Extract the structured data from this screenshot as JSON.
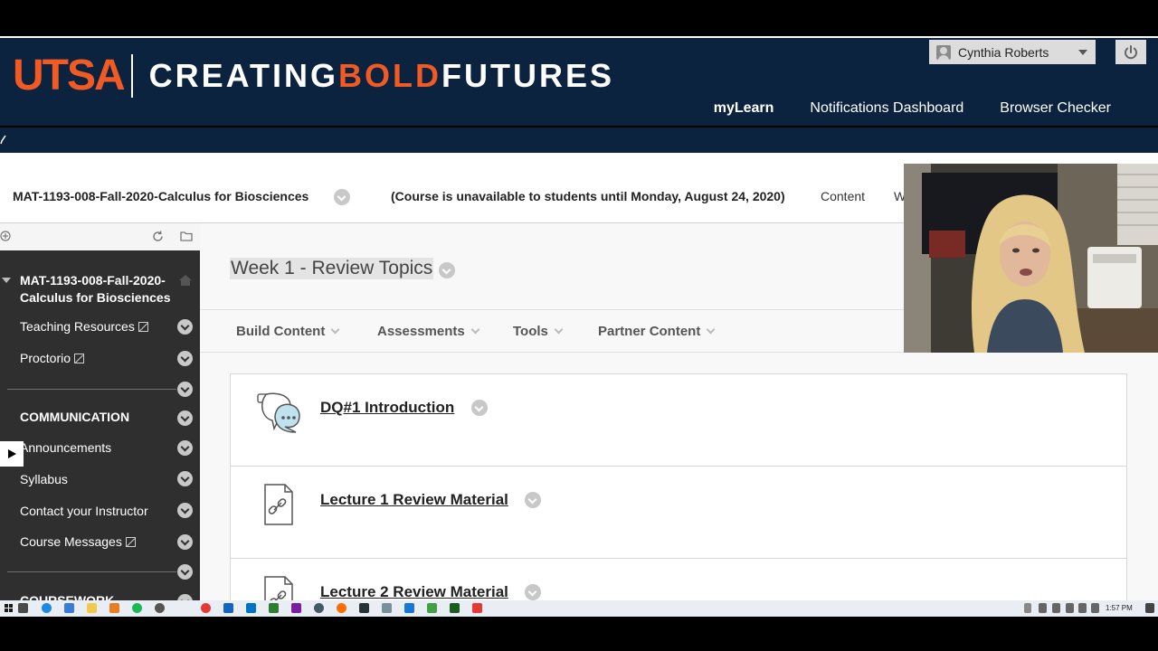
{
  "banner": {
    "brand_name": "UTSA",
    "tagline_1": "CREATING",
    "tagline_2": "BOLD",
    "tagline_3": "FUTURES",
    "user_name": "Cynthia Roberts",
    "nav": [
      "myLearn",
      "Notifications Dashboard",
      "Browser Checker"
    ],
    "active_nav": "myLearn"
  },
  "course_bar": {
    "title": "MAT-1193-008-Fall-2020-Calculus for Biosciences",
    "availability": "(Course is unavailable to students until Monday, August 24, 2020)",
    "tab_content": "Content",
    "tab_partial": "W"
  },
  "sidebar": {
    "course_name": "MAT-1193-008-Fall-2020-Calculus for Biosciences",
    "items": [
      {
        "label": "Teaching Resources",
        "external": true
      },
      {
        "label": "Proctorio",
        "external": true
      },
      {
        "label": "COMMUNICATION",
        "heading": true
      },
      {
        "label": "Announcements"
      },
      {
        "label": "Syllabus"
      },
      {
        "label": "Contact your Instructor"
      },
      {
        "label": "Course Messages",
        "external": true
      },
      {
        "label": "COURSEWORK",
        "heading": true
      }
    ]
  },
  "main": {
    "page_title": "Week 1 - Review Topics",
    "actions": [
      "Build Content",
      "Assessments",
      "Tools",
      "Partner Content"
    ],
    "content_items": [
      {
        "title": "DQ#1 Introduction",
        "icon": "discussion-icon"
      },
      {
        "title": "Lecture 1 Review Material",
        "icon": "link-file-icon"
      },
      {
        "title": "Lecture 2 Review Material",
        "icon": "link-file-icon"
      }
    ]
  },
  "taskbar": {
    "time": "1:57 PM"
  },
  "colors": {
    "banner_bg": "#0c2340",
    "utsa_orange": "#f15a22",
    "sidebar_dark": "#2f2f2f"
  }
}
